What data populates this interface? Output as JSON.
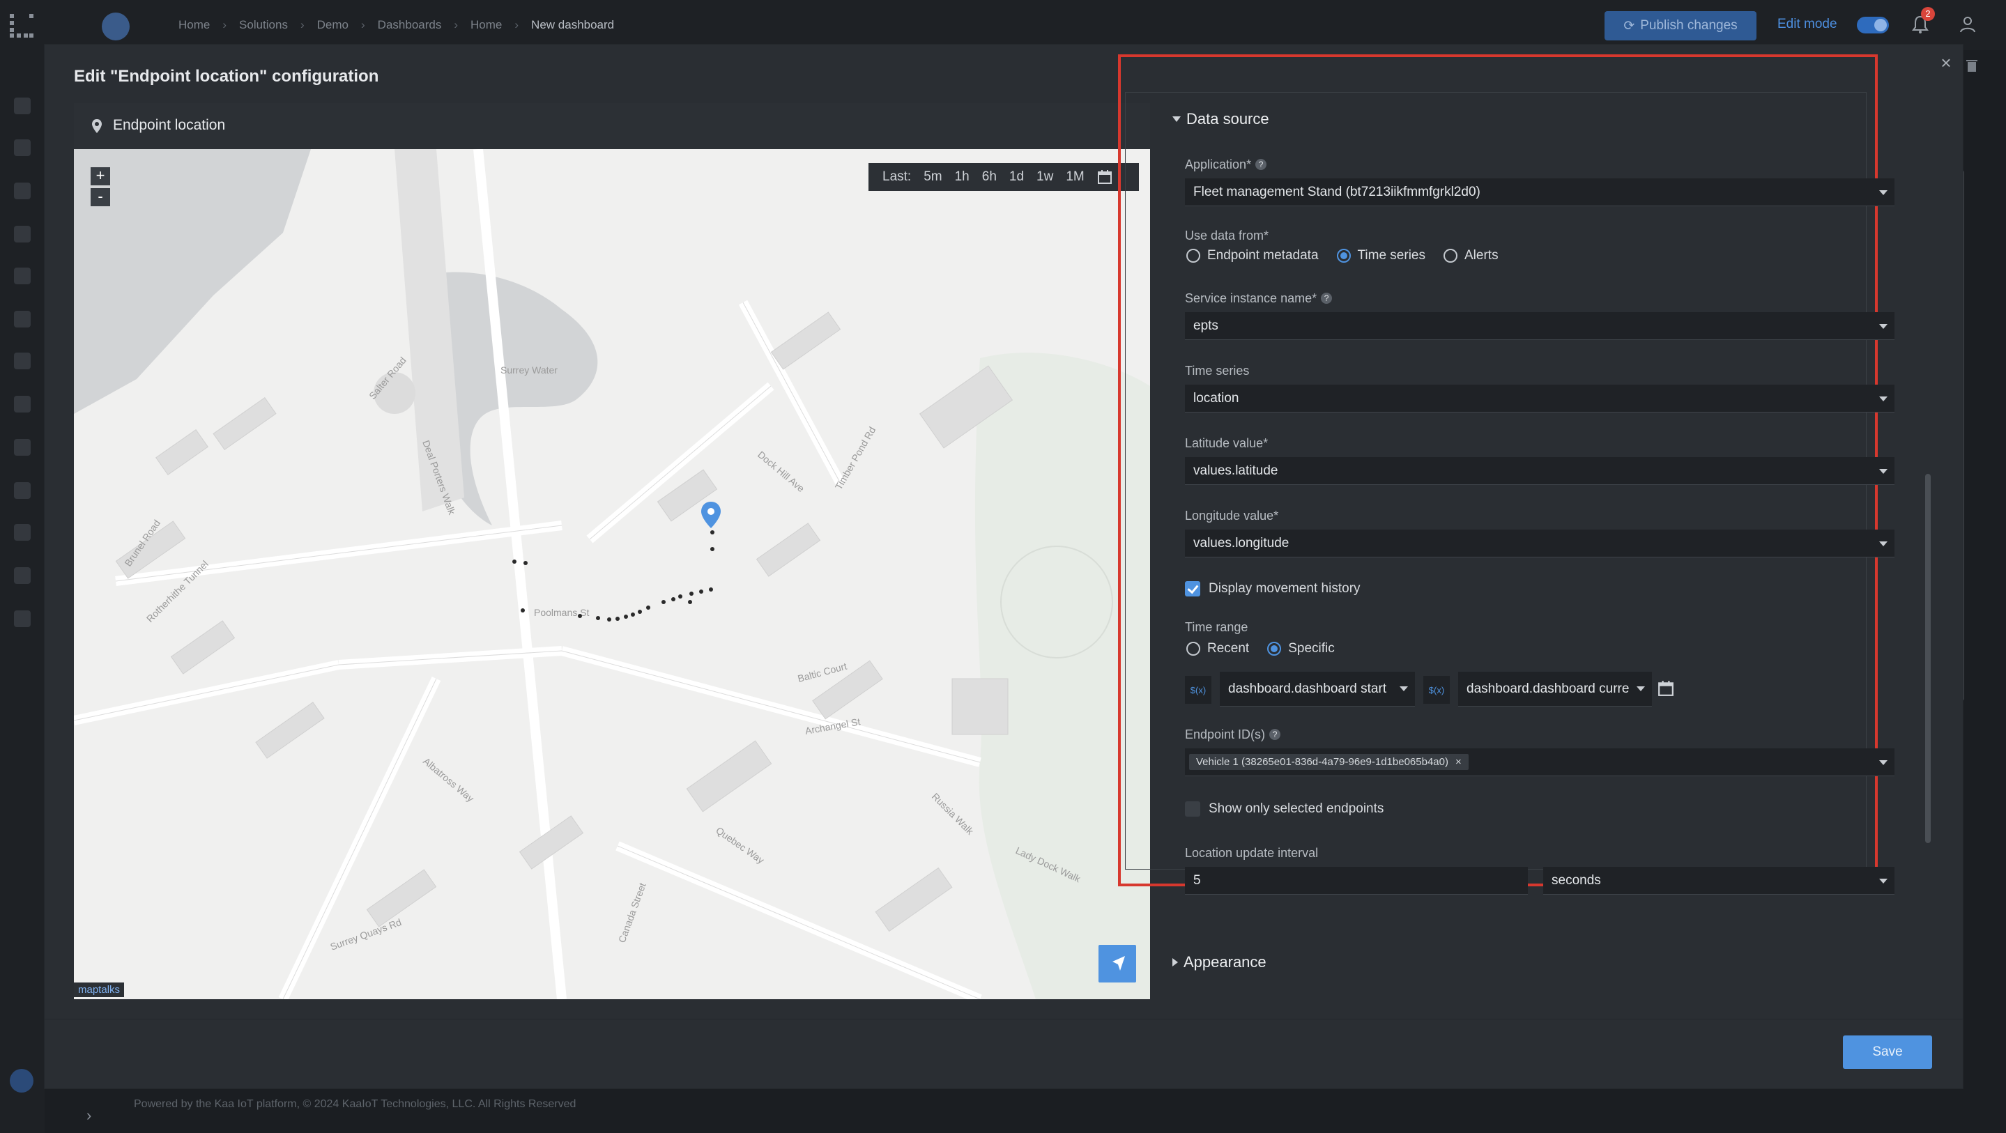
{
  "topbar": {
    "breadcrumb": [
      "Home",
      "Solutions",
      "Demo",
      "Dashboards",
      "Home",
      "New dashboard"
    ],
    "publish_label": "Publish changes",
    "edit_mode_label": "Edit mode",
    "notifications_count": "2"
  },
  "footer": {
    "text": "Powered by the Kaa IoT platform, © 2024 KaaIoT Technologies, LLC. All Rights Reserved"
  },
  "modal": {
    "title": "Edit \"Endpoint location\" configuration",
    "close_label": "×",
    "save_label": "Save"
  },
  "widget": {
    "title": "Endpoint location",
    "zoom_in": "+",
    "zoom_out": "-",
    "time_prefix": "Last:",
    "time_options": [
      "5m",
      "1h",
      "6h",
      "1d",
      "1w",
      "1M"
    ],
    "attribution": "maptalks",
    "map_labels": [
      "Surrey Water",
      "Brunel Road",
      "Salter Road",
      "Deal Porters Walk",
      "Poolmans St",
      "Timber Pond Rd",
      "Dock Hill Ave",
      "Baltic Court",
      "Archangel St",
      "Albatross Way",
      "Quebec Way",
      "Surrey Quays Rd",
      "Rotherhithe Tunnel",
      "Lady Dock Walk",
      "Russia Walk",
      "Canada Street"
    ]
  },
  "data_source": {
    "section_label": "Data source",
    "application_label": "Application",
    "application_value": "Fleet management Stand (bt7213iikfmmfgrkl2d0)",
    "use_data_label": "Use data from",
    "use_data_options": [
      "Endpoint metadata",
      "Time series",
      "Alerts"
    ],
    "use_data_selected": "Time series",
    "service_label": "Service instance name",
    "service_value": "epts",
    "time_series_label": "Time series",
    "time_series_value": "location",
    "latitude_label": "Latitude value",
    "latitude_value": "values.latitude",
    "longitude_label": "Longitude value",
    "longitude_value": "values.longitude",
    "movement_label": "Display movement history",
    "movement_checked": true,
    "time_range_label": "Time range",
    "time_range_options": [
      "Recent",
      "Specific"
    ],
    "time_range_selected": "Specific",
    "fx_label": "$(x)",
    "range_start": "dashboard.dashboard start",
    "range_end": "dashboard.dashboard curre",
    "endpoint_label": "Endpoint ID(s)",
    "endpoint_chip": "Vehicle 1 (38265e01-836d-4a79-96e9-1d1be065b4a0)",
    "show_selected_label": "Show only selected endpoints",
    "show_selected_checked": false,
    "interval_label": "Location update interval",
    "interval_value": "5",
    "interval_unit": "seconds",
    "required_mark": "*",
    "help_mark": "?"
  },
  "appearance": {
    "section_label": "Appearance"
  },
  "colors": {
    "accent": "#4f93e0",
    "highlight": "#d7382e",
    "background": "#2a2e33"
  }
}
